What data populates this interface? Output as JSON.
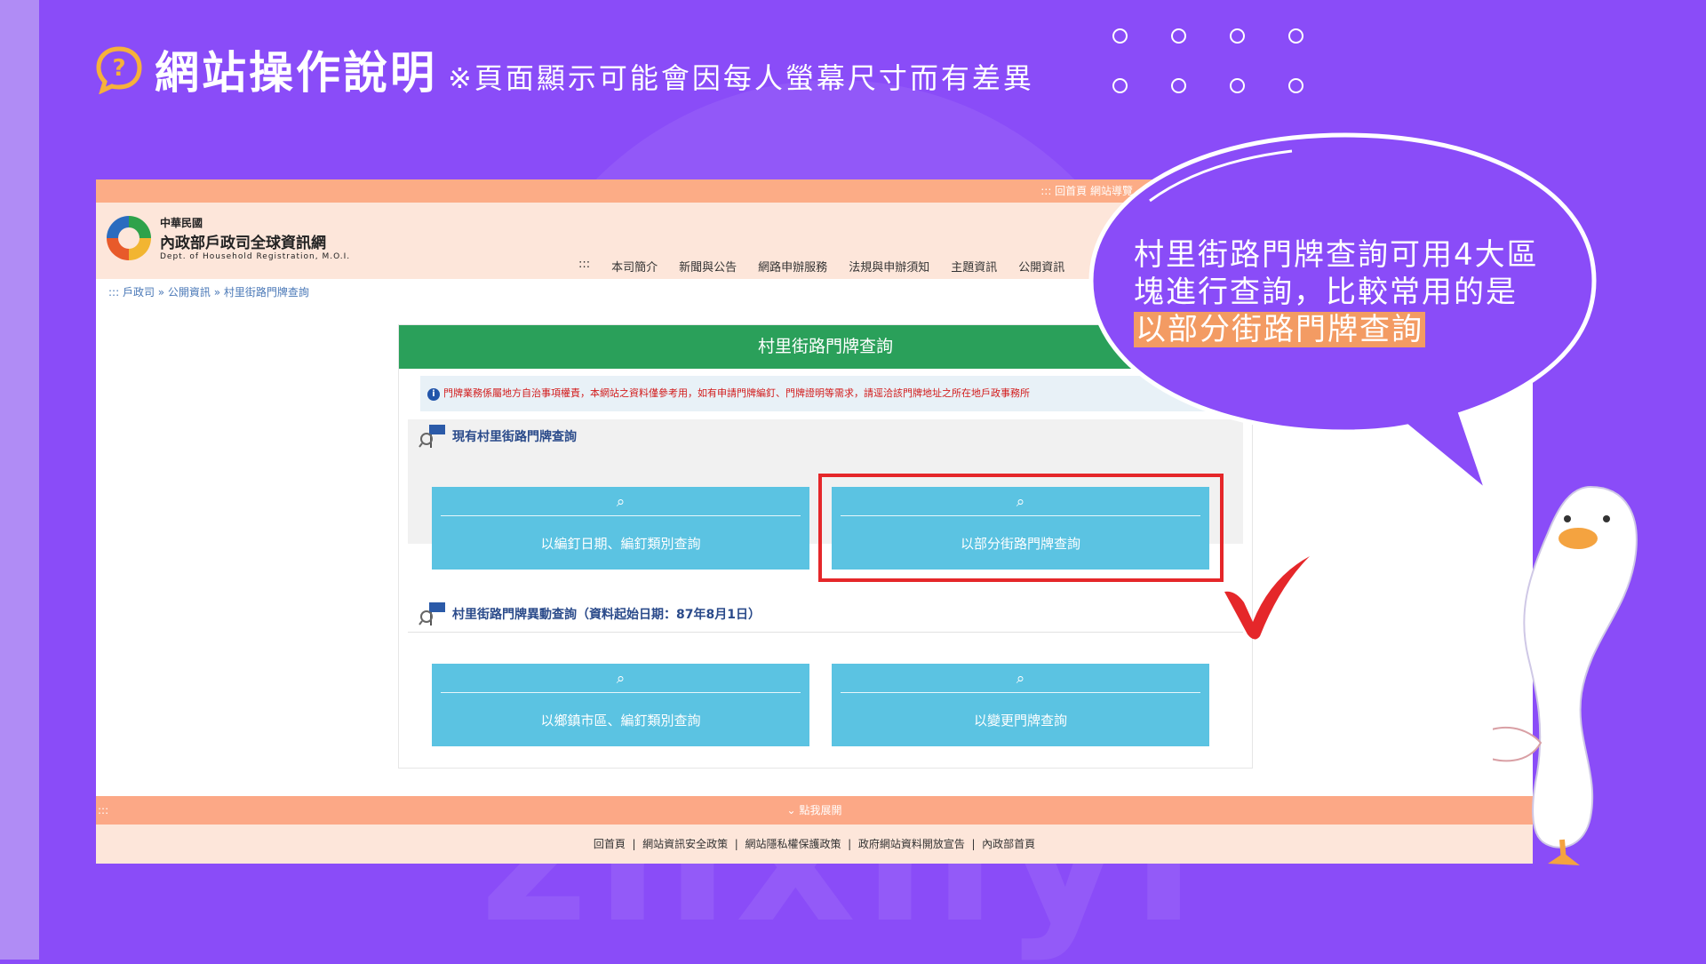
{
  "header": {
    "title": "網站操作說明",
    "subtitle": "※頁面顯示可能會因每人螢幕尺寸而有差異"
  },
  "site": {
    "topbar": "::: 回首頁 網站導覽",
    "logo_line1": "中華民國",
    "logo_line2": "內政部戶政司全球資訊網",
    "logo_line3": "Dept. of Household Registration, M.O.I.",
    "nav": [
      "本司簡介",
      "新聞與公告",
      "網路申辦服務",
      "法規與申辦須知",
      "主題資訊",
      "公開資訊"
    ],
    "nav_prefix": ":::",
    "breadcrumb": "::: 戶政司 » 公開資訊 » 村里街路門牌查詢",
    "panel_title": "村里街路門牌查詢",
    "notice": "門牌業務係屬地方自治事項權責，本網站之資料僅參考用，如有申請門牌編釘、門牌證明等需求，請逕洽該門牌地址之所在地戶政事務所",
    "section1_title": "現有村里街路門牌查詢",
    "section2_title": "村里街路門牌異動查詢（資料起始日期：87年8月1日）",
    "buttons": [
      "以編釘日期、編釘類別查詢",
      "以部分街路門牌查詢",
      "以鄉鎮市區、編釘類別查詢",
      "以變更門牌查詢"
    ],
    "expand": "點我展開",
    "expand_prefix": ":::",
    "footer_links": [
      "回首頁",
      "網站資訊安全政策",
      "網站隱私權保護政策",
      "政府網站資料開放宣告",
      "內政部首頁"
    ]
  },
  "callout": {
    "line1": "村里街路門牌查詢可用4大區",
    "line2": "塊進行查詢，比較常用的是",
    "highlight": "以部分街路門牌查詢"
  },
  "watermark": "zhxnyi",
  "colors": {
    "background": "#8a4cf8",
    "panel_header": "#2aa05a",
    "button": "#5bc3e2",
    "highlight_box": "#e5272a",
    "highlight_text_bg": "#f39b63"
  }
}
